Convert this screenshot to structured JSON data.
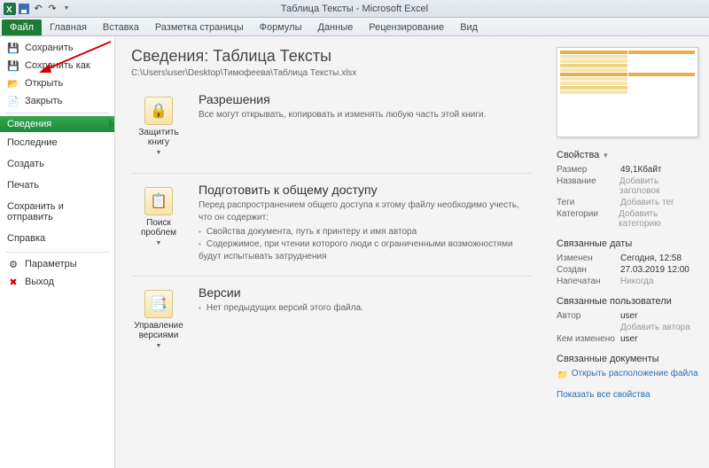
{
  "window": {
    "title": "Таблица Тексты - Microsoft Excel"
  },
  "tabs": {
    "file": "Файл",
    "home": "Главная",
    "insert": "Вставка",
    "layout": "Разметка страницы",
    "formulas": "Формулы",
    "data": "Данные",
    "review": "Рецензирование",
    "view": "Вид"
  },
  "sidebar": {
    "save": "Сохранить",
    "saveas": "Сохранить как",
    "open": "Открыть",
    "close": "Закрыть",
    "info": "Сведения",
    "recent": "Последние",
    "new": "Создать",
    "print": "Печать",
    "share": "Сохранить и отправить",
    "help": "Справка",
    "options": "Параметры",
    "exit": "Выход"
  },
  "page": {
    "title": "Сведения: Таблица Тексты",
    "path": "C:\\Users\\user\\Desktop\\Тимофеева\\Таблица Тексты.xlsx"
  },
  "sections": {
    "perm": {
      "btn": "Защитить книгу",
      "title": "Разрешения",
      "text": "Все могут открывать, копировать и изменять любую часть этой книги."
    },
    "prep": {
      "btn": "Поиск проблем",
      "title": "Подготовить к общему доступу",
      "intro": "Перед распространением общего доступа к этому файлу необходимо учесть, что он содержит:",
      "b1": "Свойства документа, путь к принтеру и имя автора",
      "b2": "Содержимое, при чтении которого люди с ограниченными возможностями будут испытывать затруднения"
    },
    "vers": {
      "btn": "Управление версиями",
      "title": "Версии",
      "text": "Нет предыдущих версий этого файла."
    }
  },
  "props": {
    "head": "Свойства",
    "size_l": "Размер",
    "size_v": "49,1Кбайт",
    "title_l": "Название",
    "title_v": "Добавить заголовок",
    "tags_l": "Теги",
    "tags_v": "Добавить тег",
    "cat_l": "Категории",
    "cat_v": "Добавить категорию",
    "dates_h": "Связанные даты",
    "mod_l": "Изменен",
    "mod_v": "Сегодня, 12:58",
    "created_l": "Создан",
    "created_v": "27.03.2019 12:00",
    "printed_l": "Напечатан",
    "printed_v": "Никогда",
    "users_h": "Связанные пользователи",
    "author_l": "Автор",
    "author_v": "user",
    "addauthor": "Добавить автора",
    "changed_l": "Кем изменено",
    "changed_v": "user",
    "docs_h": "Связанные документы",
    "openloc": "Открыть расположение файла",
    "showall": "Показать все свойства"
  }
}
